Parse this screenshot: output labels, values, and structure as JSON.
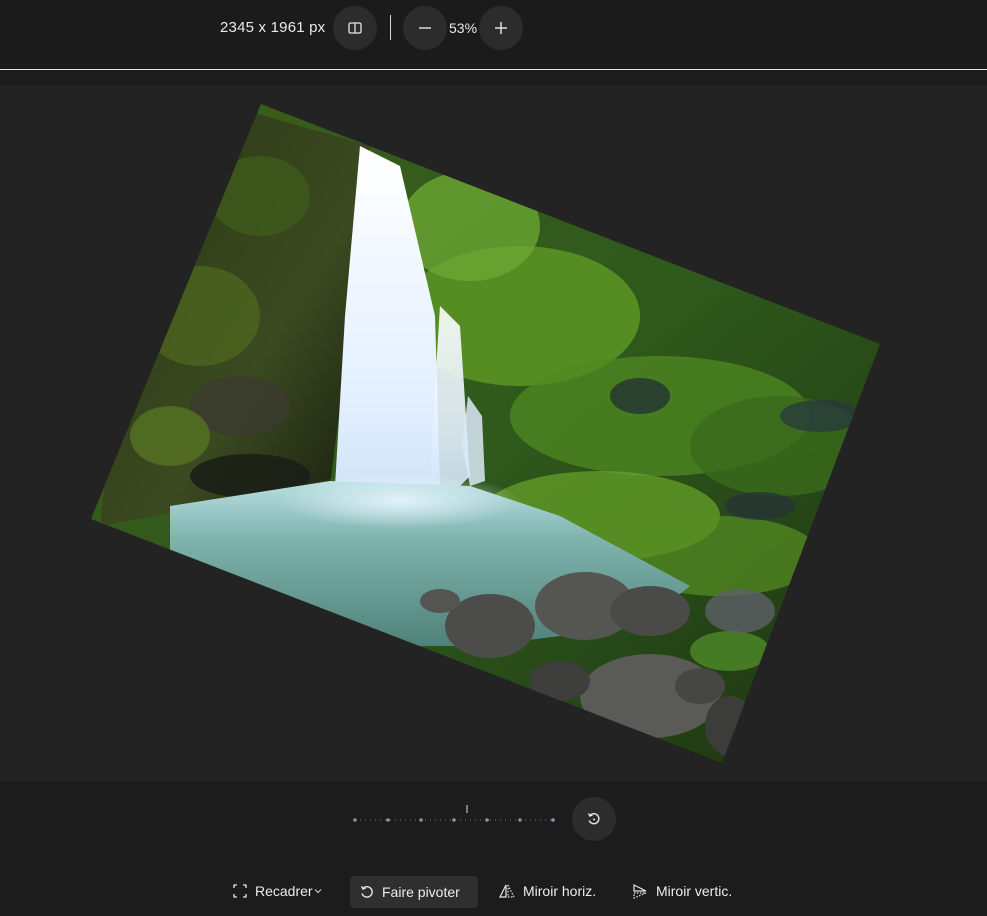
{
  "topbar": {
    "dimensions": "2345 x 1961 px",
    "zoom_level": "53%",
    "compare_icon": "split-view-icon",
    "zoom_out_icon": "minus-icon",
    "zoom_in_icon": "plus-icon"
  },
  "editor": {
    "image_subject": "waterfall",
    "rotation_reset_icon": "rotate-reset-icon"
  },
  "toolbar": {
    "crop_label": "Recadrer",
    "rotate_label": "Faire pivoter",
    "mirror_h_label": "Miroir horiz.",
    "mirror_v_label": "Miroir vertic.",
    "active_tool": "Faire pivoter"
  },
  "colors": {
    "background": "#1c1c1c",
    "canvas": "#232323",
    "button": "#2c2c2c",
    "active_tool": "#2f2f2f",
    "slider_dots": "#8a92b8"
  }
}
